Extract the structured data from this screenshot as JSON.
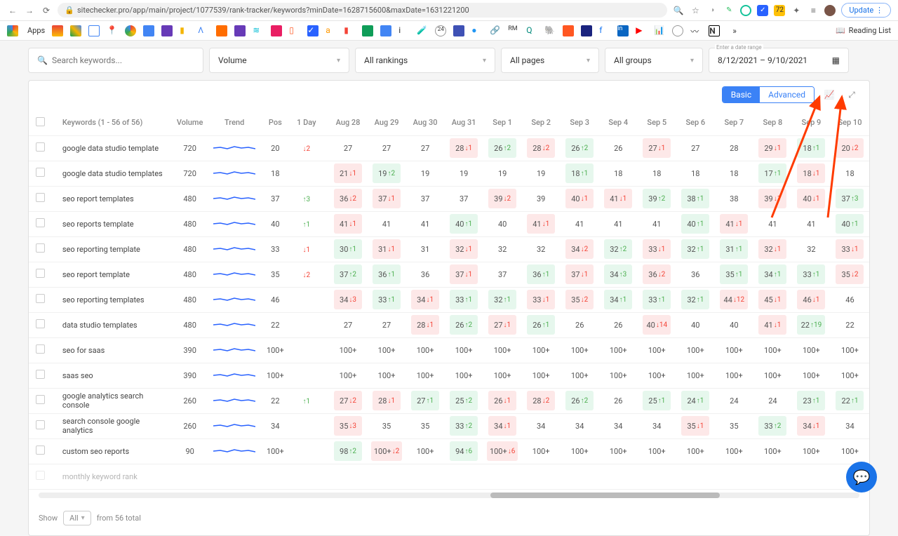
{
  "browser": {
    "url": "sitechecker.pro/app/main/project/1077539/rank-tracker/keywords?minDate=1628715600&maxDate=1631221200",
    "update_label": "Update",
    "apps_label": "Apps",
    "reading_label": "Reading List"
  },
  "filters": {
    "search_placeholder": "Search keywords...",
    "volume": "Volume",
    "rankings": "All rankings",
    "pages": "All pages",
    "groups": "All groups",
    "date_label": "Enter a date range",
    "date_range": "8/12/2021 – 9/10/2021"
  },
  "segmented": {
    "basic": "Basic",
    "advanced": "Advanced"
  },
  "headers": {
    "keywords": "Keywords (1 - 56 of 56)",
    "volume": "Volume",
    "trend": "Trend",
    "pos": "Pos",
    "one_day": "1 Day",
    "dates": [
      "Aug 28",
      "Aug 29",
      "Aug 30",
      "Aug 31",
      "Sep 1",
      "Sep 2",
      "Sep 3",
      "Sep 4",
      "Sep 5",
      "Sep 6",
      "Sep 7",
      "Sep 8",
      "Sep 9",
      "Sep 10"
    ]
  },
  "rows": [
    {
      "kw": "google data studio template",
      "vol": "720",
      "pos": "20",
      "d": "↓2",
      "cells": [
        [
          "27",
          "",
          ""
        ],
        [
          "27",
          "",
          ""
        ],
        [
          "27",
          "",
          ""
        ],
        [
          "28",
          "↓1",
          "r"
        ],
        [
          "26",
          "↑2",
          "g"
        ],
        [
          "28",
          "↓2",
          "r"
        ],
        [
          "26",
          "↑2",
          "g"
        ],
        [
          "26",
          "",
          ""
        ],
        [
          "27",
          "↓1",
          "r"
        ],
        [
          "27",
          "",
          ""
        ],
        [
          "28",
          "",
          ""
        ],
        [
          "29",
          "↓1",
          "r"
        ],
        [
          "18",
          "↑1",
          "g"
        ],
        [
          "20",
          "↓2",
          "r"
        ]
      ]
    },
    {
      "kw": "google data studio templates",
      "vol": "720",
      "pos": "18",
      "d": "",
      "cells": [
        [
          "21",
          "↓1",
          "r"
        ],
        [
          "19",
          "↑2",
          "g"
        ],
        [
          "19",
          "",
          ""
        ],
        [
          "19",
          "",
          ""
        ],
        [
          "19",
          "",
          ""
        ],
        [
          "19",
          "",
          ""
        ],
        [
          "18",
          "↑1",
          "g"
        ],
        [
          "18",
          "",
          ""
        ],
        [
          "18",
          "",
          ""
        ],
        [
          "18",
          "",
          ""
        ],
        [
          "18",
          "",
          ""
        ],
        [
          "17",
          "↑1",
          "g"
        ],
        [
          "18",
          "↓1",
          "r"
        ],
        [
          "18",
          "",
          ""
        ]
      ]
    },
    {
      "kw": "seo report templates",
      "vol": "480",
      "pos": "37",
      "d": "↑3",
      "cells": [
        [
          "36",
          "↓2",
          "r"
        ],
        [
          "37",
          "↓1",
          "r"
        ],
        [
          "37",
          "",
          ""
        ],
        [
          "37",
          "",
          ""
        ],
        [
          "39",
          "↓2",
          "r"
        ],
        [
          "39",
          "",
          ""
        ],
        [
          "40",
          "↓1",
          "r"
        ],
        [
          "41",
          "↓1",
          "r"
        ],
        [
          "39",
          "↑2",
          "g"
        ],
        [
          "38",
          "↑1",
          "g"
        ],
        [
          "38",
          "",
          ""
        ],
        [
          "39",
          "↓1",
          "r"
        ],
        [
          "40",
          "↓1",
          "r"
        ],
        [
          "37",
          "↑3",
          "g"
        ]
      ]
    },
    {
      "kw": "seo reports template",
      "vol": "480",
      "pos": "40",
      "d": "↑1",
      "cells": [
        [
          "41",
          "↓1",
          "r"
        ],
        [
          "41",
          "",
          ""
        ],
        [
          "41",
          "",
          ""
        ],
        [
          "40",
          "↑1",
          "g"
        ],
        [
          "40",
          "",
          ""
        ],
        [
          "41",
          "↓1",
          "r"
        ],
        [
          "41",
          "",
          ""
        ],
        [
          "41",
          "",
          ""
        ],
        [
          "41",
          "",
          ""
        ],
        [
          "40",
          "↑1",
          "g"
        ],
        [
          "41",
          "↓1",
          "r"
        ],
        [
          "41",
          "",
          ""
        ],
        [
          "41",
          "",
          ""
        ],
        [
          "40",
          "↑1",
          "g"
        ]
      ]
    },
    {
      "kw": "seo reporting template",
      "vol": "480",
      "pos": "33",
      "d": "↓1",
      "cells": [
        [
          "30",
          "↑1",
          "g"
        ],
        [
          "31",
          "↓1",
          "r"
        ],
        [
          "31",
          "",
          ""
        ],
        [
          "32",
          "↓1",
          "r"
        ],
        [
          "32",
          "",
          ""
        ],
        [
          "32",
          "",
          ""
        ],
        [
          "34",
          "↓2",
          "r"
        ],
        [
          "32",
          "↑2",
          "g"
        ],
        [
          "33",
          "↓1",
          "r"
        ],
        [
          "32",
          "↑1",
          "g"
        ],
        [
          "31",
          "↑1",
          "g"
        ],
        [
          "32",
          "↓1",
          "r"
        ],
        [
          "32",
          "",
          ""
        ],
        [
          "33",
          "↓1",
          "r"
        ]
      ]
    },
    {
      "kw": "seo report template",
      "vol": "480",
      "pos": "35",
      "d": "↓2",
      "cells": [
        [
          "37",
          "↑2",
          "g"
        ],
        [
          "36",
          "↑1",
          "g"
        ],
        [
          "36",
          "",
          ""
        ],
        [
          "37",
          "↓1",
          "r"
        ],
        [
          "37",
          "",
          ""
        ],
        [
          "36",
          "↑1",
          "g"
        ],
        [
          "37",
          "↓1",
          "r"
        ],
        [
          "34",
          "↑3",
          "g"
        ],
        [
          "36",
          "↓2",
          "r"
        ],
        [
          "36",
          "",
          ""
        ],
        [
          "35",
          "↑1",
          "g"
        ],
        [
          "34",
          "↑1",
          "g"
        ],
        [
          "33",
          "↑1",
          "g"
        ],
        [
          "35",
          "↓2",
          "r"
        ]
      ]
    },
    {
      "kw": "seo reporting templates",
      "vol": "480",
      "pos": "46",
      "d": "",
      "cells": [
        [
          "34",
          "↓3",
          "r"
        ],
        [
          "33",
          "↑1",
          "g"
        ],
        [
          "34",
          "↓1",
          "r"
        ],
        [
          "33",
          "↑1",
          "g"
        ],
        [
          "32",
          "↑1",
          "g"
        ],
        [
          "33",
          "↓1",
          "r"
        ],
        [
          "35",
          "↓2",
          "r"
        ],
        [
          "34",
          "↑1",
          "g"
        ],
        [
          "33",
          "↑1",
          "g"
        ],
        [
          "32",
          "↑1",
          "g"
        ],
        [
          "44",
          "↓12",
          "r"
        ],
        [
          "45",
          "↓1",
          "r"
        ],
        [
          "46",
          "↓1",
          "r"
        ],
        [
          "46",
          "",
          ""
        ]
      ]
    },
    {
      "kw": "data studio templates",
      "vol": "480",
      "pos": "22",
      "d": "",
      "cells": [
        [
          "27",
          "",
          ""
        ],
        [
          "27",
          "",
          ""
        ],
        [
          "28",
          "↓1",
          "r"
        ],
        [
          "26",
          "↑2",
          "g"
        ],
        [
          "27",
          "↓1",
          "r"
        ],
        [
          "26",
          "↑1",
          "g"
        ],
        [
          "26",
          "",
          ""
        ],
        [
          "26",
          "",
          ""
        ],
        [
          "40",
          "↓14",
          "r"
        ],
        [
          "40",
          "",
          ""
        ],
        [
          "40",
          "",
          ""
        ],
        [
          "41",
          "↓1",
          "r"
        ],
        [
          "22",
          "↑19",
          "g"
        ],
        [
          "22",
          "",
          ""
        ]
      ]
    },
    {
      "kw": "seo for saas",
      "vol": "390",
      "pos": "100+",
      "d": "",
      "cells": [
        [
          "100+",
          "",
          ""
        ],
        [
          "100+",
          "",
          ""
        ],
        [
          "100+",
          "",
          ""
        ],
        [
          "100+",
          "",
          ""
        ],
        [
          "100+",
          "",
          ""
        ],
        [
          "100+",
          "",
          ""
        ],
        [
          "100+",
          "",
          ""
        ],
        [
          "100+",
          "",
          ""
        ],
        [
          "100+",
          "",
          ""
        ],
        [
          "100+",
          "",
          ""
        ],
        [
          "100+",
          "",
          ""
        ],
        [
          "100+",
          "",
          ""
        ],
        [
          "100+",
          "",
          ""
        ],
        [
          "100+",
          "",
          ""
        ]
      ]
    },
    {
      "kw": "saas seo",
      "vol": "390",
      "pos": "100+",
      "d": "",
      "cells": [
        [
          "100+",
          "",
          ""
        ],
        [
          "100+",
          "",
          ""
        ],
        [
          "100+",
          "",
          ""
        ],
        [
          "100+",
          "",
          ""
        ],
        [
          "100+",
          "",
          ""
        ],
        [
          "100+",
          "",
          ""
        ],
        [
          "100+",
          "",
          ""
        ],
        [
          "100+",
          "",
          ""
        ],
        [
          "100+",
          "",
          ""
        ],
        [
          "100+",
          "",
          ""
        ],
        [
          "100+",
          "",
          ""
        ],
        [
          "100+",
          "",
          ""
        ],
        [
          "100+",
          "",
          ""
        ],
        [
          "100+",
          "",
          ""
        ]
      ]
    },
    {
      "kw": "google analytics search console",
      "vol": "260",
      "pos": "22",
      "d": "↑1",
      "cells": [
        [
          "27",
          "↓2",
          "r"
        ],
        [
          "28",
          "↓1",
          "r"
        ],
        [
          "27",
          "↑1",
          "g"
        ],
        [
          "25",
          "↑2",
          "g"
        ],
        [
          "26",
          "↓1",
          "r"
        ],
        [
          "28",
          "↓2",
          "r"
        ],
        [
          "26",
          "↑2",
          "g"
        ],
        [
          "26",
          "",
          ""
        ],
        [
          "25",
          "↑1",
          "g"
        ],
        [
          "24",
          "↑1",
          "g"
        ],
        [
          "24",
          "",
          ""
        ],
        [
          "24",
          "",
          ""
        ],
        [
          "23",
          "↑1",
          "g"
        ],
        [
          "22",
          "↑1",
          "g"
        ]
      ]
    },
    {
      "kw": "search console google analytics",
      "vol": "260",
      "pos": "34",
      "d": "",
      "cells": [
        [
          "35",
          "↓3",
          "r"
        ],
        [
          "35",
          "",
          ""
        ],
        [
          "35",
          "",
          ""
        ],
        [
          "33",
          "↑2",
          "g"
        ],
        [
          "34",
          "↓1",
          "r"
        ],
        [
          "34",
          "",
          ""
        ],
        [
          "34",
          "",
          ""
        ],
        [
          "34",
          "",
          ""
        ],
        [
          "34",
          "",
          ""
        ],
        [
          "35",
          "↓1",
          "r"
        ],
        [
          "35",
          "",
          ""
        ],
        [
          "33",
          "↑2",
          "g"
        ],
        [
          "34",
          "↓1",
          "r"
        ],
        [
          "34",
          "",
          ""
        ]
      ]
    },
    {
      "kw": "custom seo reports",
      "vol": "90",
      "pos": "100+",
      "d": "",
      "cells": [
        [
          "98",
          "↑2",
          "g"
        ],
        [
          "100+",
          "↓2",
          "r"
        ],
        [
          "100+",
          "",
          ""
        ],
        [
          "94",
          "↑6",
          "g"
        ],
        [
          "100+",
          "↓6",
          "r"
        ],
        [
          "100+",
          "",
          ""
        ],
        [
          "100+",
          "",
          ""
        ],
        [
          "100+",
          "",
          ""
        ],
        [
          "100+",
          "",
          ""
        ],
        [
          "100+",
          "",
          ""
        ],
        [
          "100+",
          "",
          ""
        ],
        [
          "100+",
          "",
          ""
        ],
        [
          "100+",
          "",
          ""
        ],
        [
          "100+",
          "",
          ""
        ]
      ]
    }
  ],
  "partial_row": {
    "kw": "monthly keyword rank"
  },
  "footer": {
    "show": "Show",
    "all": "All",
    "from": "from 56 total"
  }
}
